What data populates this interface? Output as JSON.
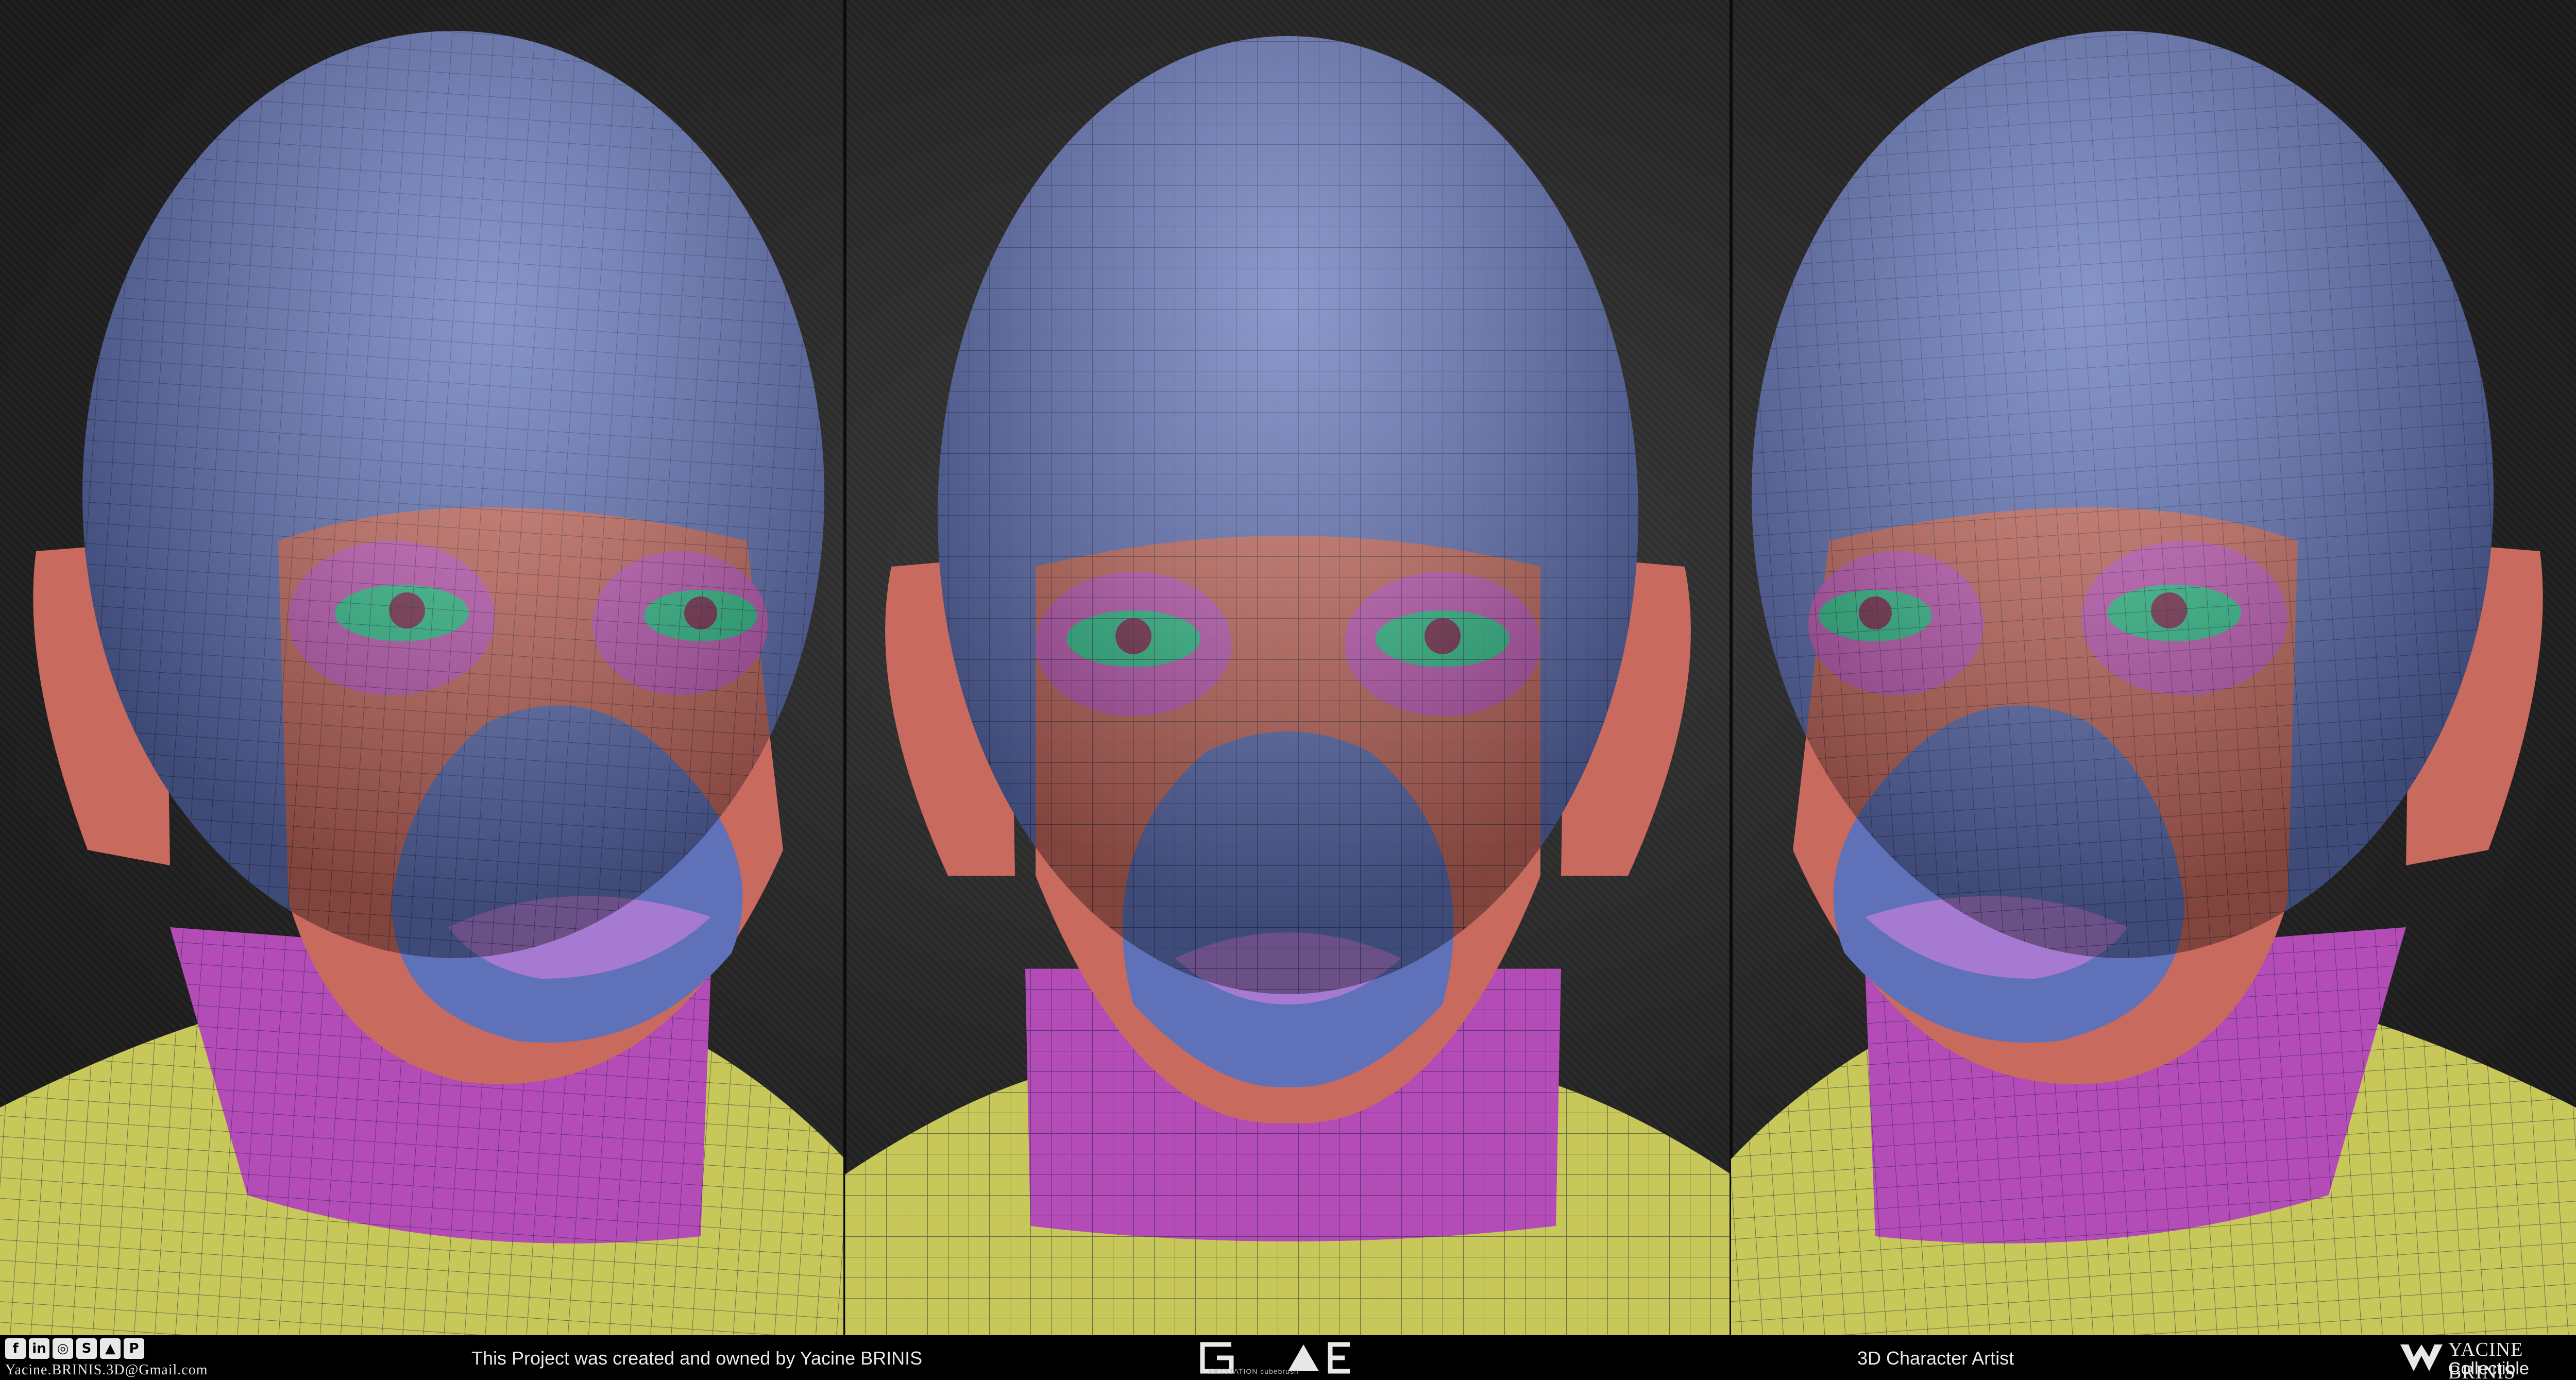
{
  "footer": {
    "social_icons": [
      "facebook-icon",
      "linkedin-icon",
      "instagram-icon",
      "skype-icon",
      "artstation-icon",
      "pinterest-icon"
    ],
    "email": "Yacine.BRINIS.3D@Gmail.com",
    "credit": "This Project was created and owned by Yacine BRINIS",
    "logo_caption": "ARTSTATION  cubebrush",
    "role": "3D Character Artist",
    "brand_name": "YACINE BRINIS",
    "brand_sub": "Collectible Studios"
  },
  "views": [
    "three-quarter-left",
    "front",
    "three-quarter-right"
  ],
  "colors": {
    "head_blue": "#5f71b8",
    "face_red": "#c86a5e",
    "eye_pink": "#c45ab8",
    "eye_green": "#2fc28c",
    "lips_purple": "#a57ad0",
    "neck_magenta": "#b44cb8",
    "shoulder_yellow": "#c8c85a"
  }
}
